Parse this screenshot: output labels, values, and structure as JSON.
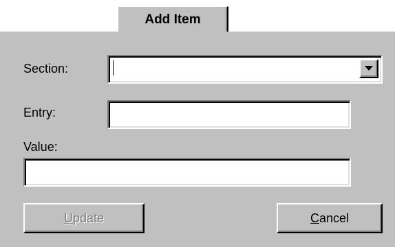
{
  "tab": {
    "label": "Add Item"
  },
  "form": {
    "section_label": "Section:",
    "section_value": "",
    "entry_label": "Entry:",
    "entry_value": "",
    "value_label": "Value:",
    "value_value": ""
  },
  "buttons": {
    "update_mnemonic": "U",
    "update_rest": "pdate",
    "update_enabled": false,
    "cancel_mnemonic": "C",
    "cancel_rest": "ancel",
    "cancel_enabled": true
  },
  "icons": {
    "combo_arrow": "chevron-down-icon"
  },
  "colors": {
    "panel": "#c0c0c0",
    "field": "#ffffff",
    "disabled_text": "#808080"
  }
}
